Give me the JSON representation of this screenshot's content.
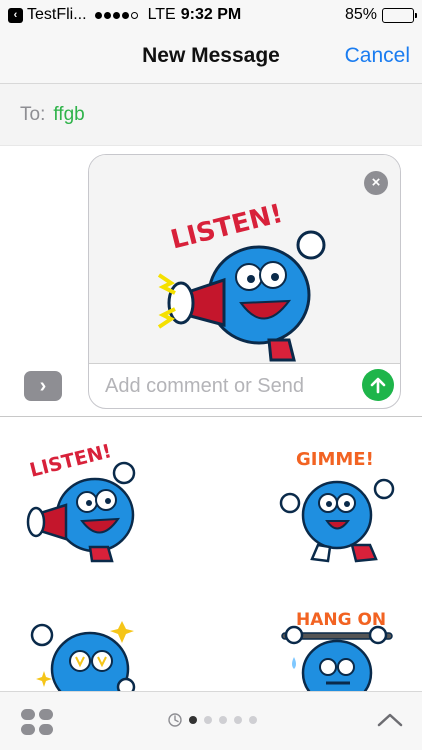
{
  "status_bar": {
    "back_app": "TestFli...",
    "network": "LTE",
    "time": "9:32 PM",
    "battery_text": "85%",
    "battery_level": 0.85,
    "signal_bars_filled": 4,
    "signal_bars_total": 5
  },
  "nav": {
    "title": "New Message",
    "cancel_label": "Cancel"
  },
  "recipient": {
    "to_label": "To:",
    "name": "ffgb"
  },
  "compose": {
    "placeholder": "Add comment or Send",
    "comment_value": ""
  },
  "stickers": [
    {
      "name": "listen",
      "text": "LISTEN!",
      "color": "#d8213a"
    },
    {
      "name": "gimme",
      "text": "GIMME!",
      "color": "#f26322"
    },
    {
      "name": "salute",
      "text": "",
      "color": "#f5c518"
    },
    {
      "name": "hang-on",
      "text": "HANG ON",
      "color": "#f26322"
    }
  ],
  "drawer_nav": {
    "page_count": 5,
    "active_page": 0
  },
  "colors": {
    "accent_blue": "#1a7cf0",
    "recipient_green": "#2fb34a",
    "send_green": "#1eb54a",
    "monster_blue": "#1f8fe0"
  }
}
